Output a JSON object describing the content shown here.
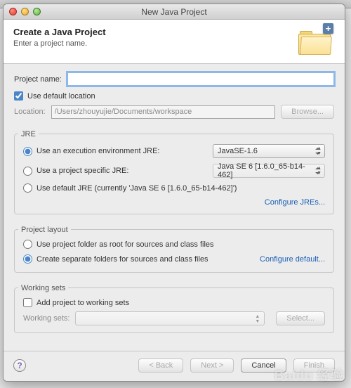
{
  "window": {
    "title": "New Java Project"
  },
  "banner": {
    "heading": "Create a Java Project",
    "subtitle": "Enter a project name."
  },
  "form": {
    "project_name_label": "Project name:",
    "project_name_value": "",
    "use_default_location": "Use default location",
    "location_label": "Location:",
    "location_value": "/Users/zhouyujie/Documents/workspace",
    "browse_label": "Browse..."
  },
  "jre": {
    "group_label": "JRE",
    "exec_env_label": "Use an execution environment JRE:",
    "exec_env_value": "JavaSE-1.6",
    "project_jre_label": "Use a project specific JRE:",
    "project_jre_value": "Java SE 6 [1.6.0_65-b14-462]",
    "default_jre_label": "Use default JRE (currently 'Java SE 6 [1.6.0_65-b14-462]')",
    "configure_link": "Configure JREs..."
  },
  "layout": {
    "group_label": "Project layout",
    "root_option": "Use project folder as root for sources and class files",
    "separate_option": "Create separate folders for sources and class files",
    "configure_link": "Configure default..."
  },
  "ws": {
    "group_label": "Working sets",
    "add_label": "Add project to working sets",
    "sets_label": "Working sets:",
    "select_label": "Select..."
  },
  "footer": {
    "back": "< Back",
    "next": "Next >",
    "cancel": "Cancel",
    "finish": "Finish"
  }
}
